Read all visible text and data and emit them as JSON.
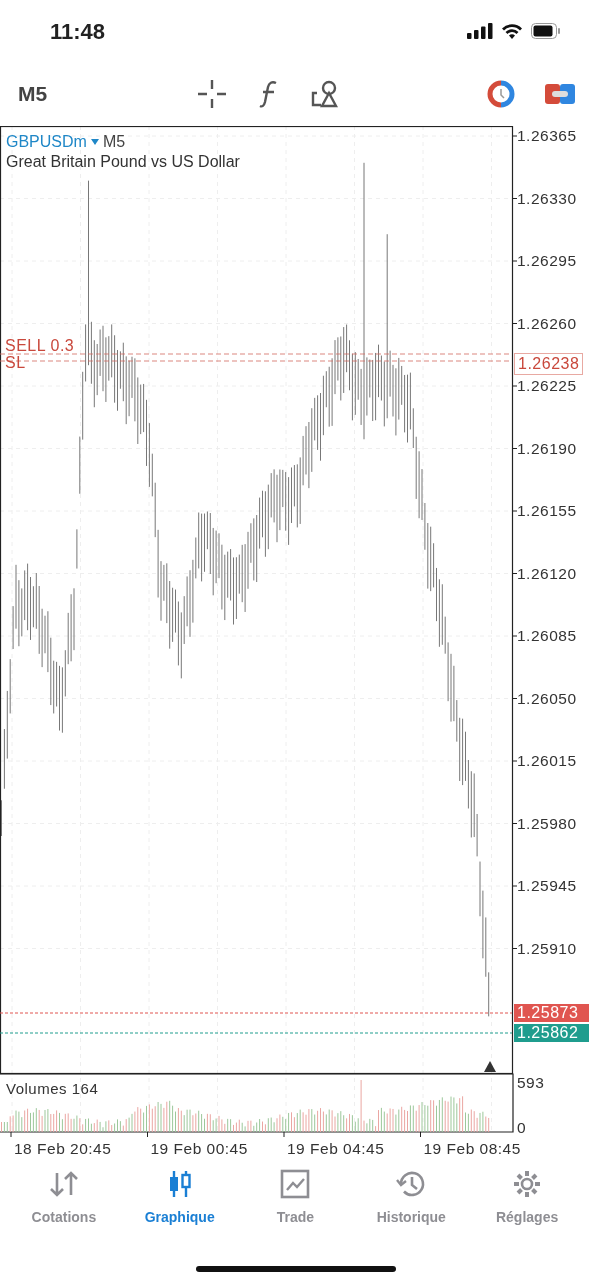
{
  "status_bar": {
    "time": "11:48"
  },
  "toolbar": {
    "timeframe": "M5"
  },
  "chart": {
    "symbol": "GBPUSDm",
    "timeframe": "M5",
    "description": "Great Britain Pound vs US Dollar",
    "price_ticks": [
      "1.26365",
      "1.26330",
      "1.26295",
      "1.26260",
      "1.26225",
      "1.26190",
      "1.26155",
      "1.26120",
      "1.26085",
      "1.26050",
      "1.26015",
      "1.25980",
      "1.25945",
      "1.25910"
    ],
    "orders": [
      {
        "label": "SELL 0.3"
      },
      {
        "label": "SL"
      }
    ],
    "order_price": "1.26238",
    "price_lines": [
      {
        "price": "1.25873",
        "color": "#e05550"
      },
      {
        "price": "1.25862",
        "color": "#1f9d8e"
      }
    ],
    "volumes": {
      "label": "Volumes 164",
      "max": "593",
      "min": "0"
    },
    "time_labels": [
      "18 Feb 20:45",
      "19 Feb 00:45",
      "19 Feb 04:45",
      "19 Feb 08:45"
    ]
  },
  "tabs": [
    {
      "label": "Cotations",
      "selected": false
    },
    {
      "label": "Graphique",
      "selected": true
    },
    {
      "label": "Trade",
      "selected": false
    },
    {
      "label": "Historique",
      "selected": false
    },
    {
      "label": "Réglages",
      "selected": false
    }
  ]
}
